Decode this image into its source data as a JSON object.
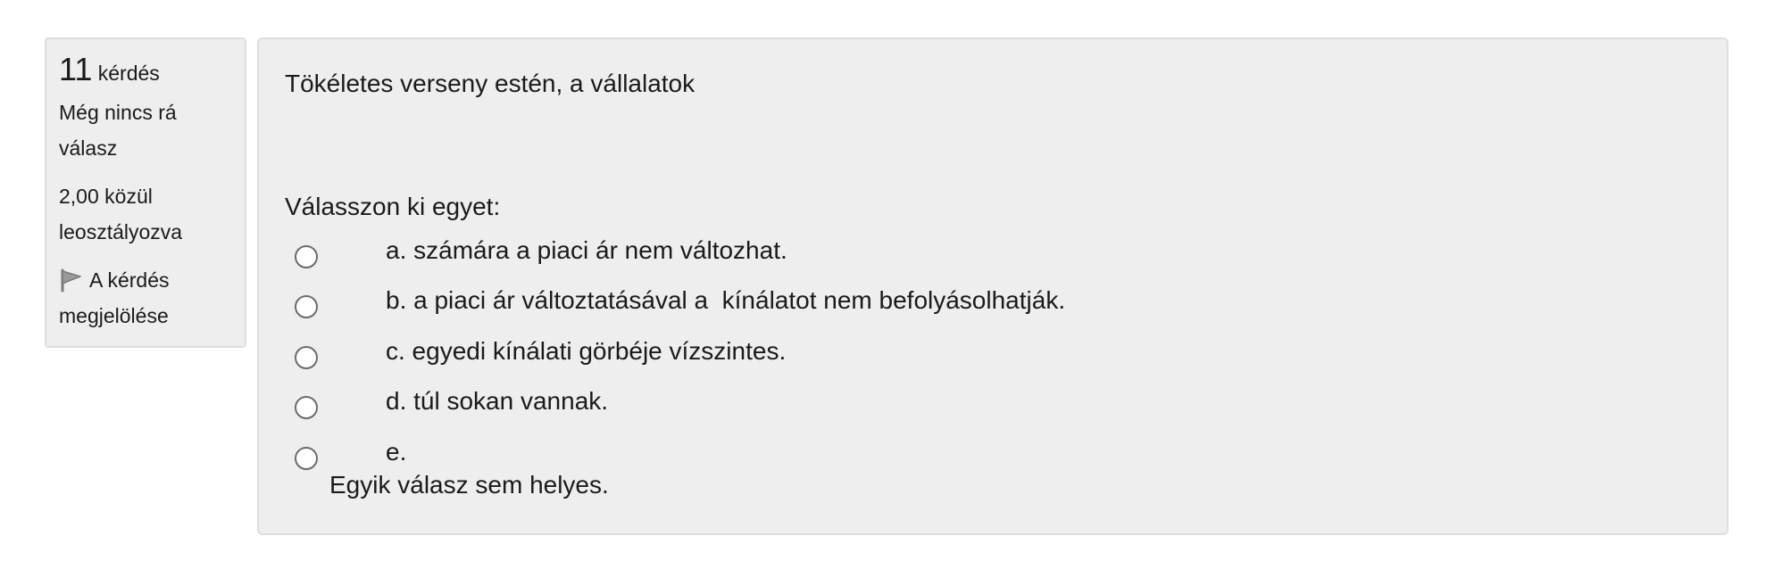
{
  "info": {
    "question_number": "11",
    "question_label": "kérdés",
    "status": "Még nincs rá válasz",
    "grade": "2,00 közül leosztályozva",
    "flag_label": "A kérdés megjelölése"
  },
  "question": {
    "text": "Tökéletes verseny estén, a vállalatok",
    "prompt": "Válasszon ki egyet:",
    "options": [
      {
        "label": "a. számára a piaci ár nem változhat."
      },
      {
        "label": "b. a piaci ár változtatásával a  kínálatot nem befolyásolhatják."
      },
      {
        "label": "c. egyedi kínálati görbéje vízszintes."
      },
      {
        "label": "d. túl sokan vannak."
      },
      {
        "label": "e."
      }
    ],
    "option_e_extra": "Egyik válasz sem helyes."
  },
  "icons": {
    "flag": "flag-icon",
    "radio": "radio-unchecked-icon"
  },
  "colors": {
    "panel_background": "#eeeeee",
    "panel_border": "#dedede",
    "text": "#1a1a1a"
  }
}
